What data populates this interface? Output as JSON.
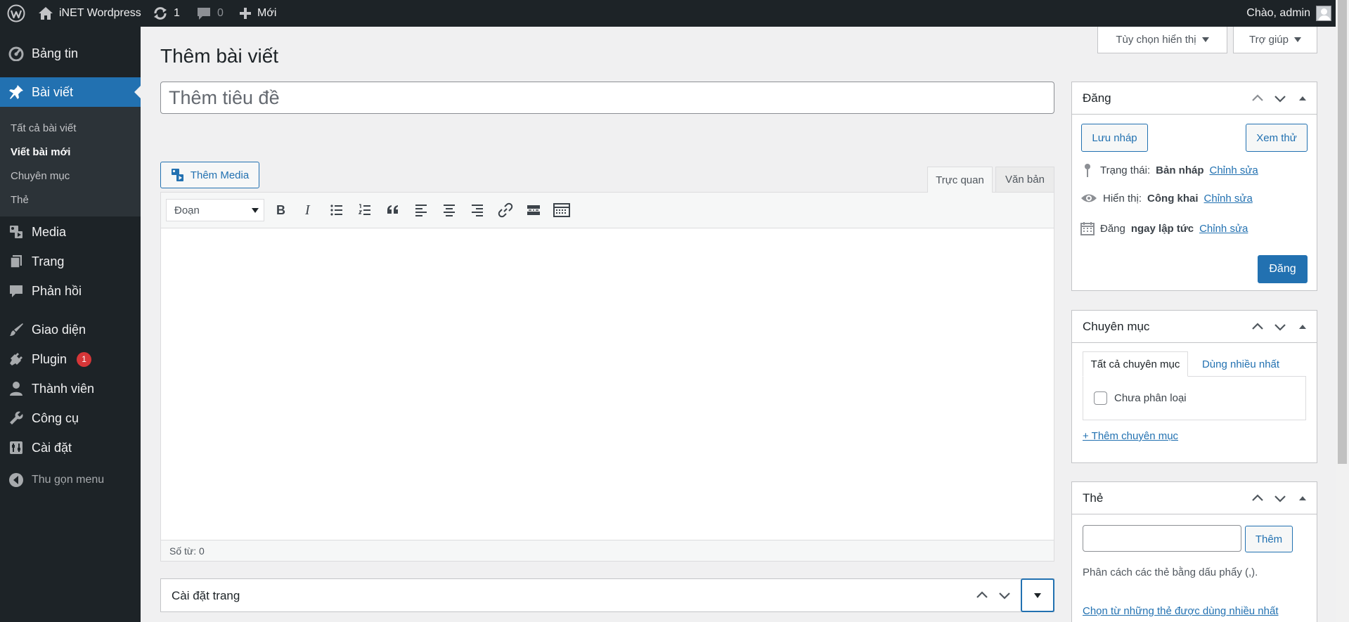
{
  "adminbar": {
    "site_name": "iNET Wordpress",
    "updates_count": "1",
    "comments_count": "0",
    "new_label": "Mới",
    "greeting": "Chào, admin"
  },
  "sidebar": {
    "items": [
      {
        "label": "Bảng tin",
        "icon": "dashboard-icon"
      },
      {
        "label": "Bài viết",
        "icon": "pin-icon",
        "current": true
      },
      {
        "label": "Media",
        "icon": "media-icon"
      },
      {
        "label": "Trang",
        "icon": "pages-icon"
      },
      {
        "label": "Phản hồi",
        "icon": "comments-icon"
      },
      {
        "label": "Giao diện",
        "icon": "brush-icon"
      },
      {
        "label": "Plugin",
        "icon": "plugin-icon",
        "badge": "1"
      },
      {
        "label": "Thành viên",
        "icon": "user-icon"
      },
      {
        "label": "Công cụ",
        "icon": "wrench-icon"
      },
      {
        "label": "Cài đặt",
        "icon": "settings-icon"
      }
    ],
    "submenu": [
      "Tất cả bài viết",
      "Viết bài mới",
      "Chuyên mục",
      "Thẻ"
    ],
    "collapse_label": "Thu gọn menu"
  },
  "screen_options": {
    "options_label": "Tùy chọn hiển thị",
    "help_label": "Trợ giúp"
  },
  "editor": {
    "page_title": "Thêm bài viết",
    "title_placeholder": "Thêm tiêu đề",
    "add_media_label": "Thêm Media",
    "tab_visual": "Trực quan",
    "tab_text": "Văn bản",
    "format_value": "Đoạn",
    "word_count": "Số từ: 0",
    "page_settings_title": "Cài đặt trang"
  },
  "publish": {
    "title": "Đăng",
    "save_draft": "Lưu nháp",
    "preview": "Xem thử",
    "status_label": "Trạng thái:",
    "status_value": "Bản nháp",
    "visibility_label": "Hiển thị:",
    "visibility_value": "Công khai",
    "schedule_label": "Đăng",
    "schedule_value": "ngay lập tức",
    "edit_link": "Chỉnh sửa",
    "publish_button": "Đăng"
  },
  "categories": {
    "title": "Chuyên mục",
    "tab_all": "Tất cả chuyên mục",
    "tab_popular": "Dùng nhiều nhất",
    "items": [
      "Chưa phân loại"
    ],
    "add_link": "+ Thêm chuyên mục"
  },
  "tags": {
    "title": "Thẻ",
    "add_button": "Thêm",
    "hint": "Phân cách các thẻ bằng dấu phẩy (,).",
    "choose_link": "Chọn từ những thẻ được dùng nhiều nhất"
  },
  "colors": {
    "admin_dark": "#1d2327",
    "accent": "#2271b1",
    "badge_red": "#d63638"
  }
}
